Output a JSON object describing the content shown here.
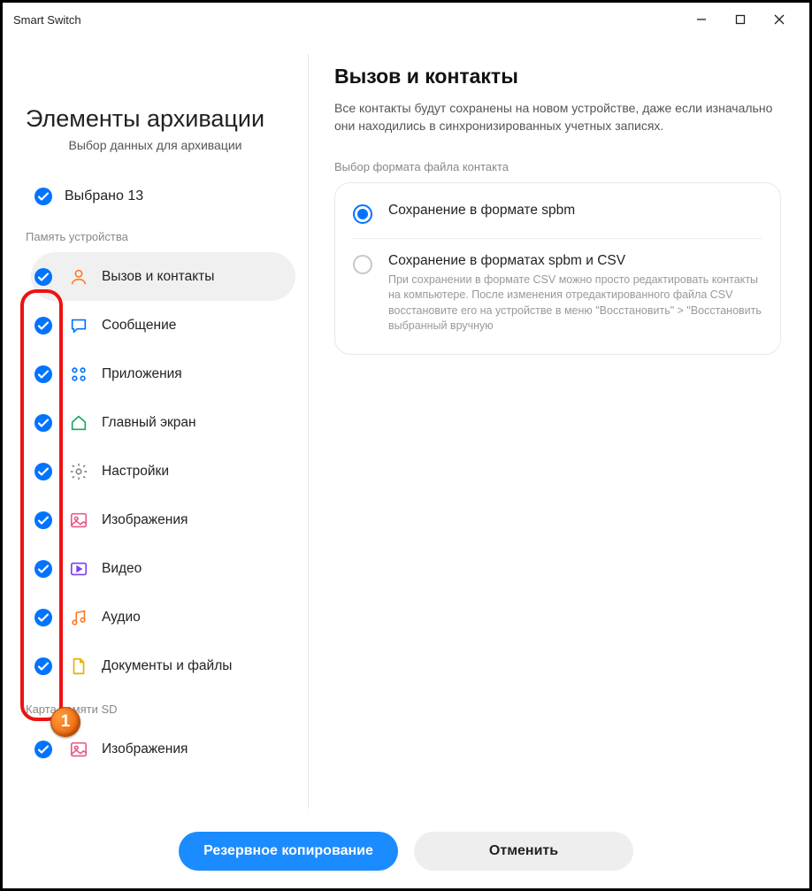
{
  "window": {
    "title": "Smart Switch"
  },
  "left": {
    "heading": "Элементы архивации",
    "sub": "Выбор данных для архивации",
    "selected": "Выбрано 13",
    "group1": "Память устройства",
    "group2": "Карта памяти SD",
    "items1": [
      {
        "label": "Вызов и контакты"
      },
      {
        "label": "Сообщение"
      },
      {
        "label": "Приложения"
      },
      {
        "label": "Главный экран"
      },
      {
        "label": "Настройки"
      },
      {
        "label": "Изображения"
      },
      {
        "label": "Видео"
      },
      {
        "label": "Аудио"
      },
      {
        "label": "Документы и файлы"
      }
    ],
    "items2": [
      {
        "label": "Изображения"
      }
    ],
    "badge": "1"
  },
  "right": {
    "heading": "Вызов и контакты",
    "desc": "Все контакты будут сохранены на новом устройстве, даже если изначально они находились в синхронизированных учетных записях.",
    "groupname": "Выбор формата файла контакта",
    "opt1": {
      "title": "Сохранение в формате spbm"
    },
    "opt2": {
      "title": "Сохранение в форматах spbm и CSV",
      "desc": "При сохранении в формате CSV можно просто редактировать контакты на компьютере. После изменения отредактированного файла CSV восстановите его на устройстве в меню \"Восстановить\" > \"Восстановить выбранный вручную"
    }
  },
  "footer": {
    "backup": "Резервное копирование",
    "cancel": "Отменить"
  }
}
